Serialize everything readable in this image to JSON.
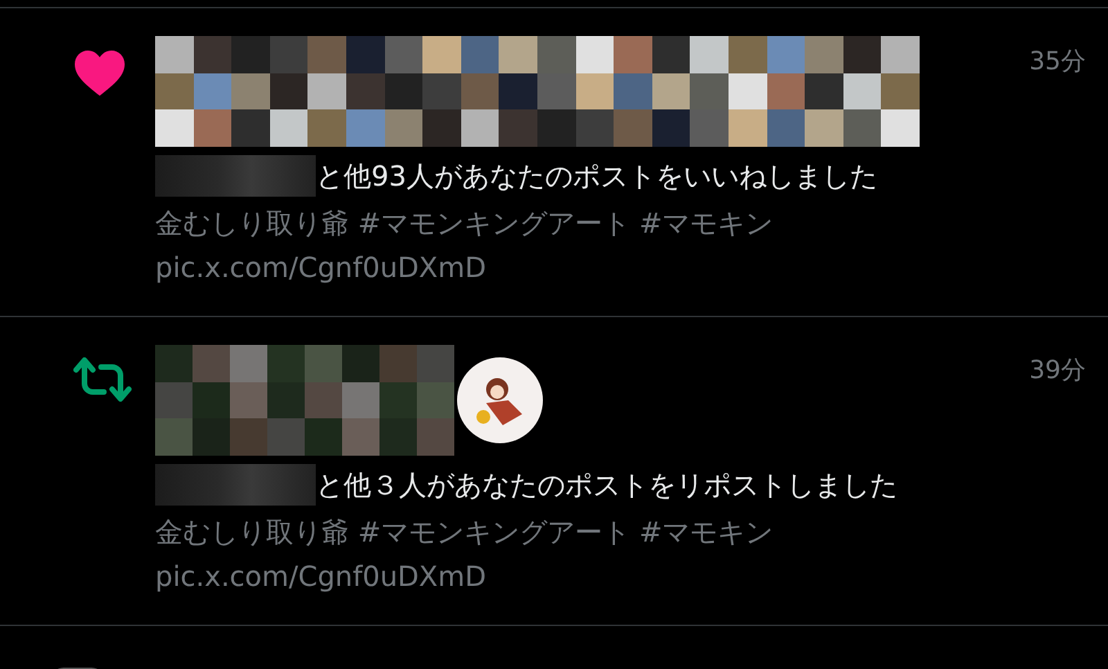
{
  "notifications": [
    {
      "kind": "like",
      "time": "35分",
      "message": "と他93人があなたのポストをいいねしました",
      "post_text": "金むしり取り爺 #マモンキングアート #マモキン",
      "link": "pic.x.com/Cgnf0uDXmD",
      "extra_avatar": false
    },
    {
      "kind": "repost",
      "time": "39分",
      "message": "と他３人があなたのポストをリポストしました",
      "post_text": "金むしり取り爺 #マモンキングアート #マモキン",
      "link": "pic.x.com/Cgnf0uDXmD",
      "extra_avatar": true
    }
  ]
}
